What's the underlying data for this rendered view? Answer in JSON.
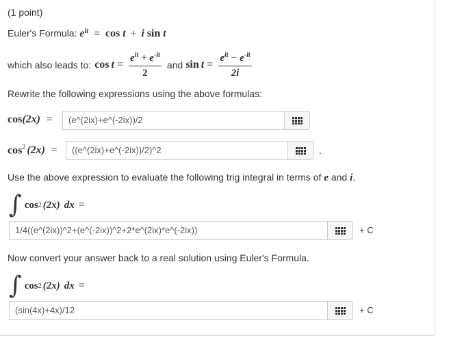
{
  "header": {
    "points": "(1 point)"
  },
  "euler": {
    "label": "Euler's Formula:",
    "lhs_base": "e",
    "lhs_exp": "it",
    "eq": "=",
    "rhs_cos": "cos",
    "rhs_t1": "t",
    "plus": "+",
    "rhs_i": "i",
    "rhs_sin": "sin",
    "rhs_t2": "t"
  },
  "leads": {
    "label": "which also leads to:",
    "cos": "cos",
    "t": "t",
    "eq": "=",
    "cos_num": "e^{it} + e^{-it}",
    "cos_den": "2",
    "and": "and",
    "sin": "sin",
    "sin_num": "e^{it} − e^{-it}",
    "sin_den": "2i"
  },
  "rewrite": {
    "prompt": "Rewrite the following expressions using the above formulas:"
  },
  "q1": {
    "label_fn": "cos",
    "label_arg": "(2x)",
    "eq": "=",
    "value": "(e^(2ix)+e^(-2ix))/2"
  },
  "q2": {
    "label_fn": "cos",
    "label_exp": "2",
    "label_arg": "(2x)",
    "eq": "=",
    "value": "((e^(2ix)+e^(-2ix))/2)^2",
    "trailing": "."
  },
  "use": {
    "prompt_pre": "Use the above expression to evaluate the following trig integral in terms of",
    "e": "e",
    "and": "and",
    "i": "i",
    "end": "."
  },
  "q3": {
    "integrand_fn": "cos",
    "integrand_exp": "2",
    "integrand_arg": "(2x)",
    "dx": "dx",
    "eq": "=",
    "value": "1/4((e^(2ix))^2+(e^(-2ix))^2+2*e^(2ix)*e^(-2ix))",
    "suffix": "+ C"
  },
  "convert": {
    "prompt": "Now convert your answer back to a real solution using Euler's Formula."
  },
  "q4": {
    "integrand_fn": "cos",
    "integrand_exp": "2",
    "integrand_arg": "(2x)",
    "dx": "dx",
    "eq": "=",
    "value": "(sin(4x)+4x)/12",
    "suffix": "+ C"
  }
}
